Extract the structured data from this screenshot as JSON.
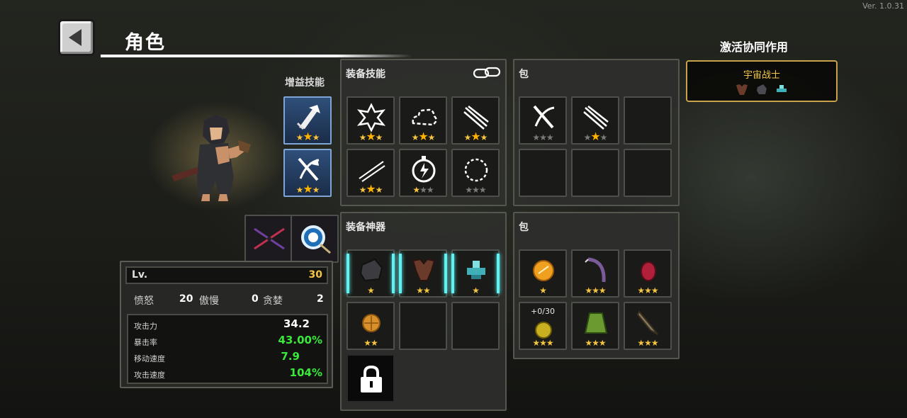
{
  "version": "Ver. 1.0.31",
  "header": {
    "title": "角色"
  },
  "buff_skills": {
    "label": "增益技能",
    "slots": [
      {
        "icon": "sword-burst-icon",
        "stars": "★★★"
      },
      {
        "icon": "crossbow-icon",
        "stars": "★★★"
      }
    ]
  },
  "weapons": [
    {
      "icon": "crossed-blades-icon"
    },
    {
      "icon": "blue-orb-icon"
    }
  ],
  "equip_skills": {
    "title": "装备技能",
    "link_icon": "chain-link-icon",
    "slots": [
      {
        "icon": "explosion-icon",
        "stars": "★★★"
      },
      {
        "icon": "smoke-cloud-icon",
        "stars": "★★★"
      },
      {
        "icon": "claw-slash-icon",
        "stars": "★★★"
      },
      {
        "icon": "lightning-slash-icon",
        "stars": "★★★"
      },
      {
        "icon": "thunder-orb-icon",
        "stars": "★★★"
      },
      {
        "icon": "spark-ring-icon",
        "stars": "★★★"
      }
    ]
  },
  "skill_bag": {
    "title": "包",
    "slots": [
      {
        "icon": "crossbow-icon",
        "stars": "★★★"
      },
      {
        "icon": "claw-slash-icon",
        "stars": "★★★"
      },
      {},
      {},
      {},
      {}
    ]
  },
  "equip_artifacts": {
    "title": "装备神器",
    "slots": [
      {
        "icon": "stone-icon",
        "stars": "★"
      },
      {
        "icon": "leather-armor-icon",
        "stars": "★★"
      },
      {
        "icon": "cyan-gem-icon",
        "stars": "★"
      },
      {
        "icon": "bronze-coin-icon",
        "stars": "★★"
      },
      {},
      {}
    ],
    "locked_icon": "padlock-icon"
  },
  "artifact_bag": {
    "title": "包",
    "slots": [
      {
        "icon": "amber-orb-icon",
        "stars": "★"
      },
      {
        "icon": "scythe-icon",
        "stars": "★★★"
      },
      {
        "icon": "red-egg-icon",
        "stars": "★★★"
      },
      {
        "icon": "gold-nugget-icon",
        "stars": "★★★",
        "count": "+0/30"
      },
      {
        "icon": "green-cloak-icon",
        "stars": "★★★"
      },
      {
        "icon": "drill-icon",
        "stars": "★★★"
      }
    ]
  },
  "synergy": {
    "title": "激活协同作用",
    "name": "宇宙战士",
    "icons": [
      "leather-armor-icon",
      "stone-icon",
      "cyan-gem-icon"
    ]
  },
  "stats": {
    "level_label": "Lv.",
    "level": "30",
    "traits": [
      {
        "label": "愤怒",
        "value": "20"
      },
      {
        "label": "傲慢",
        "value": "0"
      },
      {
        "label": "贪婪",
        "value": "2"
      }
    ],
    "attrs": [
      {
        "label": "攻击力",
        "value": "34.2"
      },
      {
        "label": "暴击率",
        "value": "43.00%"
      },
      {
        "label": "移动速度",
        "value": "7.9"
      },
      {
        "label": "攻击速度",
        "value": "104%"
      }
    ]
  },
  "colors": {
    "accent_gold": "#f4c542",
    "stat_green": "#39e83a",
    "synergy_border": "#c8a24a",
    "cyan_highlight": "#5ff2f2"
  }
}
